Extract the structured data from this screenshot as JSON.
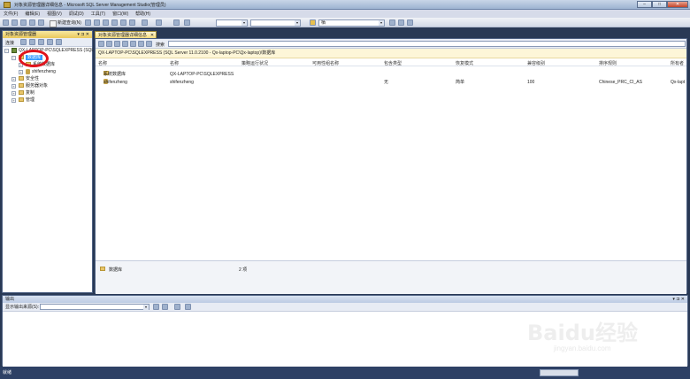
{
  "window": {
    "title": "对象资源管理器详细信息 - Microsoft SQL Server Management Studio(管理员)"
  },
  "menu": [
    "文件(F)",
    "编辑(E)",
    "视图(V)",
    "调试(D)",
    "工具(T)",
    "窗口(W)",
    "帮助(H)"
  ],
  "toolbar": {
    "new_query": "新建查询(N)",
    "db_dropdown": "",
    "solution_dropdown": "",
    "find_dropdown": "栖"
  },
  "explorer": {
    "title": "对象资源管理器",
    "connect_label": "连接",
    "server": "QX-LAPTOP-PC\\SQLEXPRESS (SQL S",
    "nodes": [
      {
        "label": "数据库",
        "selected": true
      },
      {
        "label": "系统数据库"
      },
      {
        "label": "shifenzheng"
      },
      {
        "label": "安全性"
      },
      {
        "label": "服务器对象"
      },
      {
        "label": "复制"
      },
      {
        "label": "管理"
      }
    ]
  },
  "details": {
    "tab_label": "对象资源管理器详细信息",
    "search_label": "搜索",
    "path": "QX-LAPTOP-PC\\SQLEXPRESS (SQL Server 11.0.2100 - Qx-laptop-PC\\Qx-laptop)\\数据库",
    "columns": [
      "名称",
      "名称",
      "策略运行状况",
      "可用性组名称",
      "包含类型",
      "恢复模式",
      "兼容级别",
      "排序规则",
      "所有者"
    ],
    "rows": [
      [
        "系统数据库",
        "QX-LAPTOP-PC\\SQLEXPRESS",
        "",
        "",
        "",
        "",
        "",
        "",
        ""
      ],
      [
        "shifenzheng",
        "shifenzheng",
        "",
        "",
        "无",
        "简单",
        "100",
        "Chinese_PRC_CI_AS",
        "Qx-lapt"
      ]
    ],
    "summary_label": "数据库",
    "summary_count": "2 项"
  },
  "output": {
    "title": "输出",
    "show_from_label": "显示输出来源(S):"
  },
  "status": {
    "text": "就绪"
  },
  "watermark": {
    "main": "Baidu经验",
    "sub": "jingyan.baidu.com"
  }
}
